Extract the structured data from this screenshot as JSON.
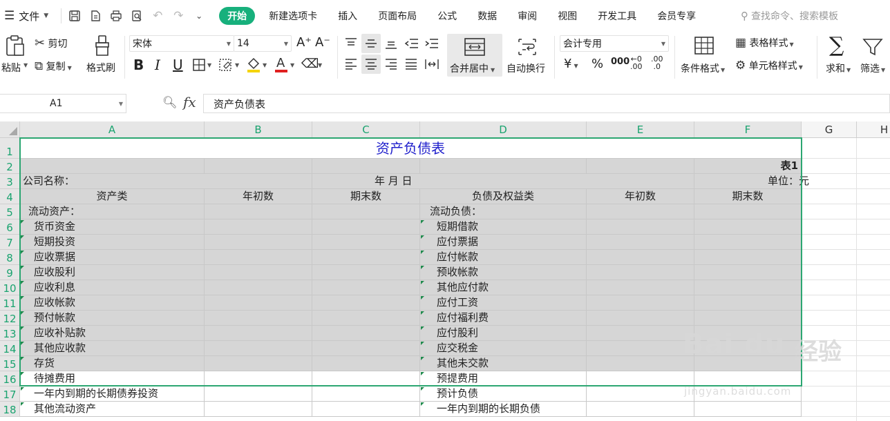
{
  "menubar": {
    "file_label": "文件",
    "active_tab": "开始",
    "tabs": [
      "新建选项卡",
      "插入",
      "页面布局",
      "公式",
      "数据",
      "审阅",
      "视图",
      "开发工具",
      "会员专享"
    ],
    "search_placeholder": "查找命令、搜索模板"
  },
  "ribbon": {
    "paste": "粘贴",
    "cut": "剪切",
    "copy": "复制",
    "format_painter": "格式刷",
    "font_name": "宋体",
    "font_size": "14",
    "merge_center": "合并居中",
    "wrap_text": "自动换行",
    "number_format": "会计专用",
    "currency_symbol": "¥",
    "percent": "%",
    "thousands": "000",
    "inc_decimal": ".00",
    "dec_decimal": ".0",
    "conditional_format": "条件格式",
    "table_style": "表格样式",
    "cell_style": "单元格样式",
    "sum": "求和",
    "filter": "筛选"
  },
  "formula_bar": {
    "cell_ref": "A1",
    "fx_label": "fx",
    "content": "资产负债表"
  },
  "sheet": {
    "columns": [
      "A",
      "B",
      "C",
      "D",
      "E",
      "F",
      "G",
      "H"
    ],
    "rows": [
      "1",
      "2",
      "3",
      "4",
      "5",
      "6",
      "7",
      "8",
      "9",
      "10",
      "11",
      "12",
      "13",
      "14",
      "15",
      "16",
      "17",
      "18"
    ],
    "title": "资产负债表",
    "table_no": "表1",
    "company_label": "公司名称：",
    "date_label": "年    月    日",
    "unit_label": "单位：元",
    "headers": {
      "assets": "资产类",
      "begin": "年初数",
      "end": "期末数",
      "liabilities": "负债及权益类",
      "begin2": "年初数",
      "end2": "期末数"
    },
    "assets": [
      "流动资产：",
      "货币资金",
      "短期投资",
      "应收票据",
      "应收股利",
      "应收利息",
      "应收帐款",
      "预付帐款",
      "应收补贴款",
      "其他应收款",
      "存货",
      "待摊费用",
      "一年内到期的长期债券投资",
      "其他流动资产"
    ],
    "liabilities": [
      "流动负债：",
      "短期借款",
      "应付票据",
      "应付帐款",
      "预收帐款",
      "其他应付款",
      "应付工资",
      "应付福利费",
      "应付股利",
      "应交税金",
      "其他未交款",
      "预提费用",
      "预计负债",
      "一年内到期的长期负债"
    ]
  },
  "watermark": {
    "brand": "Bai du",
    "subtitle": "经验",
    "url": "jingyan.baidu.com"
  },
  "colors": {
    "accent": "#17b07c",
    "selection_border": "#2ba671",
    "title_text": "#1f1fcc",
    "selected_fill": "#d6d6d6"
  }
}
